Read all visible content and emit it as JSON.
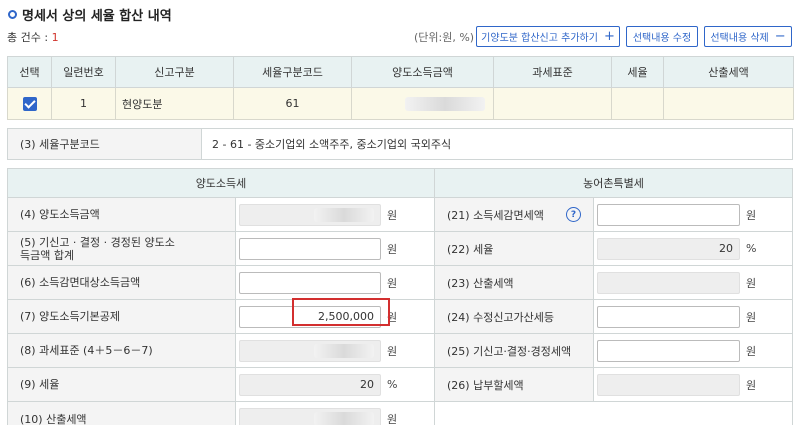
{
  "header": {
    "title": "명세서 상의 세율 합산 내역",
    "count_label": "총 건수 :",
    "count_value": "1",
    "unit_label": "(단위:원, %)"
  },
  "toolbar": {
    "add_label": "기양도분 합산신고 추가하기",
    "edit_label": "선택내용 수정",
    "delete_label": "선택내용 삭제",
    "add_symbol": "+",
    "delete_symbol": "−"
  },
  "list": {
    "columns": [
      "선택",
      "일련번호",
      "신고구분",
      "세율구분코드",
      "양도소득금액",
      "과세표준",
      "세율",
      "산출세액"
    ],
    "rows": [
      {
        "checked": true,
        "serial": "1",
        "report_type": "현양도분",
        "rate_code": "61",
        "transfer_income": "",
        "tax_base": "",
        "rate": "",
        "calculated_tax": ""
      }
    ]
  },
  "rate_code_box": {
    "label": "(3) 세율구분코드",
    "value": "2  -  61  -  중소기업외 소액주주, 중소기업외 국외주식"
  },
  "detail": {
    "left_header": "양도소득세",
    "right_header": "농어촌특별세",
    "rows": [
      {
        "l_label": "(4) 양도소득금액",
        "l_value": "",
        "l_unit": "원",
        "r_label": "(21) 소득세감면세액",
        "r_value": "",
        "r_unit": "원"
      },
      {
        "l_label": "(5) 기신고 · 결정 · 경정된 양도소득금액 합계",
        "l_value": "",
        "l_unit": "원",
        "r_label": "(22) 세율",
        "r_value": "20",
        "r_unit": "%"
      },
      {
        "l_label": "(6) 소득감면대상소득금액",
        "l_value": "",
        "l_unit": "원",
        "r_label": "(23) 산출세액",
        "r_value": "",
        "r_unit": "원"
      },
      {
        "l_label": "(7) 양도소득기본공제",
        "l_value": "2,500,000",
        "l_unit": "원",
        "r_label": "(24) 수정신고가산세등",
        "r_value": "",
        "r_unit": "원"
      },
      {
        "l_label": "(8) 과세표준 (4＋5－6－7)",
        "l_value": "",
        "l_unit": "원",
        "r_label": "(25) 기신고·결정·경정세액",
        "r_value": "",
        "r_unit": "원"
      },
      {
        "l_label": "(9) 세율",
        "l_value": "20",
        "l_unit": "%",
        "r_label": "(26) 납부할세액",
        "r_value": "",
        "r_unit": "원"
      },
      {
        "l_label": "(10) 산출세액",
        "l_value": "",
        "l_unit": "원"
      }
    ]
  },
  "icons": {
    "help_glyph": "?"
  },
  "colors": {
    "accent": "#2f66c9",
    "count": "#d0342c",
    "highlight": "#d32f2f",
    "header_bg": "#e8f2f2",
    "row_bg": "#fbf9e8"
  }
}
